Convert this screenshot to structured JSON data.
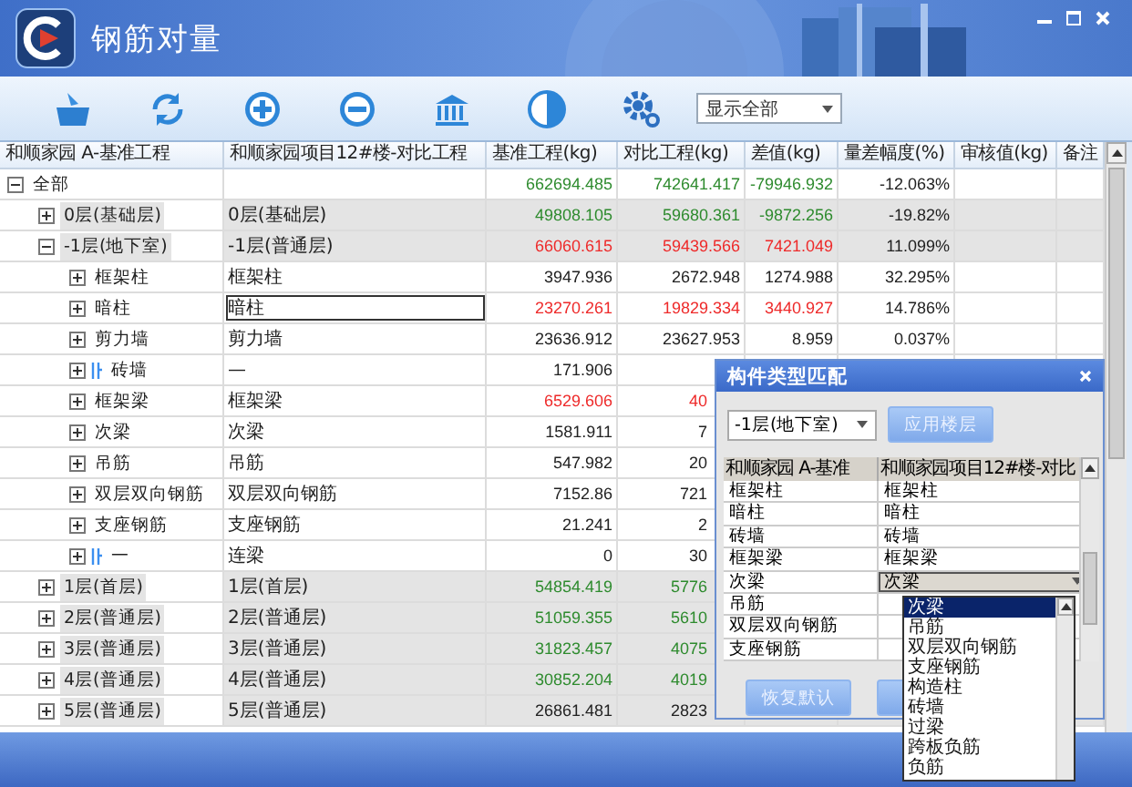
{
  "window": {
    "title": "钢筋对量"
  },
  "toolbar": {
    "display_filter": "显示全部"
  },
  "table": {
    "columns": [
      "和顺家园 A-基准工程",
      "和顺家园项目12#楼-对比工程",
      "基准工程(kg)",
      "对比工程(kg)",
      "差值(kg)",
      "量差幅度(%)",
      "审核值(kg)",
      "备注"
    ],
    "rows": [
      {
        "kind": "item",
        "name": "全部",
        "match": "",
        "expanded": true,
        "selected": false,
        "color": "#2e8b2e",
        "values": [
          "662694.485",
          "742641.417",
          "-79946.932",
          "-12.063%"
        ],
        "children": [
          {
            "kind": "floor",
            "name": "0层(基础层)",
            "match": "0层(基础层)",
            "expanded": false,
            "selected": false,
            "color": "#2e8b2e",
            "values": [
              "49808.105",
              "59680.361",
              "-9872.256",
              "-19.82%"
            ]
          },
          {
            "kind": "floor",
            "name": "-1层(地下室)",
            "match": "-1层(普通层)",
            "expanded": true,
            "selected": false,
            "color": "#ee2a2a",
            "values": [
              "66060.615",
              "59439.566",
              "7421.049",
              "11.099%"
            ],
            "children": [
              {
                "kind": "item",
                "name": "框架柱",
                "match": "框架柱",
                "expanded": false,
                "selected": false,
                "color": "#222222",
                "values": [
                  "3947.936",
                  "2672.948",
                  "1274.988",
                  "32.295%"
                ]
              },
              {
                "kind": "item",
                "name": "暗柱",
                "match": "暗柱",
                "expanded": false,
                "selected": true,
                "color": "#ee2a2a",
                "values": [
                  "23270.261",
                  "19829.334",
                  "3440.927",
                  "14.786%"
                ]
              },
              {
                "kind": "item",
                "name": "剪力墙",
                "match": "剪力墙",
                "expanded": false,
                "selected": false,
                "color": "#222222",
                "values": [
                  "23636.912",
                  "23627.953",
                  "8.959",
                  "0.037%"
                ]
              },
              {
                "kind": "tagged",
                "name": "砖墙",
                "match": "—",
                "expanded": false,
                "selected": false,
                "color": "#222222",
                "values": [
                  "171.906"
                ]
              },
              {
                "kind": "item",
                "name": "框架梁",
                "match": "框架梁",
                "expanded": false,
                "selected": false,
                "color": "#ee2a2a",
                "values": [
                  "6529.606",
                  "40"
                ]
              },
              {
                "kind": "item",
                "name": "次梁",
                "match": "次梁",
                "expanded": false,
                "selected": false,
                "color": "#222222",
                "values": [
                  "1581.911",
                  "7"
                ]
              },
              {
                "kind": "item",
                "name": "吊筋",
                "match": "吊筋",
                "expanded": false,
                "selected": false,
                "color": "#222222",
                "values": [
                  "547.982",
                  "20"
                ]
              },
              {
                "kind": "item",
                "name": "双层双向钢筋",
                "match": "双层双向钢筋",
                "expanded": false,
                "selected": false,
                "color": "#222222",
                "values": [
                  "7152.86",
                  "721"
                ]
              },
              {
                "kind": "item",
                "name": "支座钢筋",
                "match": "支座钢筋",
                "expanded": false,
                "selected": false,
                "color": "#222222",
                "values": [
                  "21.241",
                  "2"
                ]
              },
              {
                "kind": "tagged",
                "name": "一",
                "match": "连梁",
                "expanded": false,
                "selected": false,
                "color": "#222222",
                "values": [
                  "0",
                  "30"
                ]
              }
            ]
          },
          {
            "kind": "floor",
            "name": "1层(首层)",
            "match": "1层(首层)",
            "expanded": false,
            "selected": false,
            "color": "#2e8b2e",
            "values": [
              "54854.419",
              "5776"
            ]
          },
          {
            "kind": "floor",
            "name": "2层(普通层)",
            "match": "2层(普通层)",
            "expanded": false,
            "selected": false,
            "color": "#2e8b2e",
            "values": [
              "51059.355",
              "5610"
            ]
          },
          {
            "kind": "floor",
            "name": "3层(普通层)",
            "match": "3层(普通层)",
            "expanded": false,
            "selected": false,
            "color": "#2e8b2e",
            "values": [
              "31823.457",
              "4075"
            ]
          },
          {
            "kind": "floor",
            "name": "4层(普通层)",
            "match": "4层(普通层)",
            "expanded": false,
            "selected": false,
            "color": "#2e8b2e",
            "values": [
              "30852.204",
              "4019"
            ]
          },
          {
            "kind": "floor",
            "name": "5层(普通层)",
            "match": "5层(普通层)",
            "expanded": false,
            "selected": false,
            "color": "#222222",
            "values": [
              "26861.481",
              "2823"
            ]
          }
        ]
      }
    ]
  },
  "dialog": {
    "title": "构件类型匹配",
    "floor": "-1层(地下室)",
    "apply_button": "应用楼层",
    "columns": [
      "和顺家园 A-基准",
      "和顺家园项目12#楼-对比"
    ],
    "rows": [
      {
        "kind": "text",
        "base": "框架柱",
        "match": "框架柱"
      },
      {
        "kind": "text",
        "base": "暗柱",
        "match": "暗柱"
      },
      {
        "kind": "text",
        "base": "砖墙",
        "match": "砖墙"
      },
      {
        "kind": "text",
        "base": "框架梁",
        "match": "框架梁"
      },
      {
        "kind": "combo",
        "base": "次梁",
        "match": "次梁"
      },
      {
        "kind": "text",
        "base": "吊筋",
        "match": ""
      },
      {
        "kind": "text",
        "base": "双层双向钢筋",
        "match": ""
      },
      {
        "kind": "text",
        "base": "支座钢筋",
        "match": ""
      }
    ],
    "options": [
      {
        "label": "次梁",
        "selected": true
      },
      {
        "label": "吊筋",
        "selected": false
      },
      {
        "label": "双层双向钢筋",
        "selected": false
      },
      {
        "label": "支座钢筋",
        "selected": false
      },
      {
        "label": "构造柱",
        "selected": false
      },
      {
        "label": "砖墙",
        "selected": false
      },
      {
        "label": "过梁",
        "selected": false
      },
      {
        "label": "跨板负筋",
        "selected": false
      },
      {
        "label": "负筋",
        "selected": false
      }
    ],
    "reset_button": "恢复默认"
  }
}
